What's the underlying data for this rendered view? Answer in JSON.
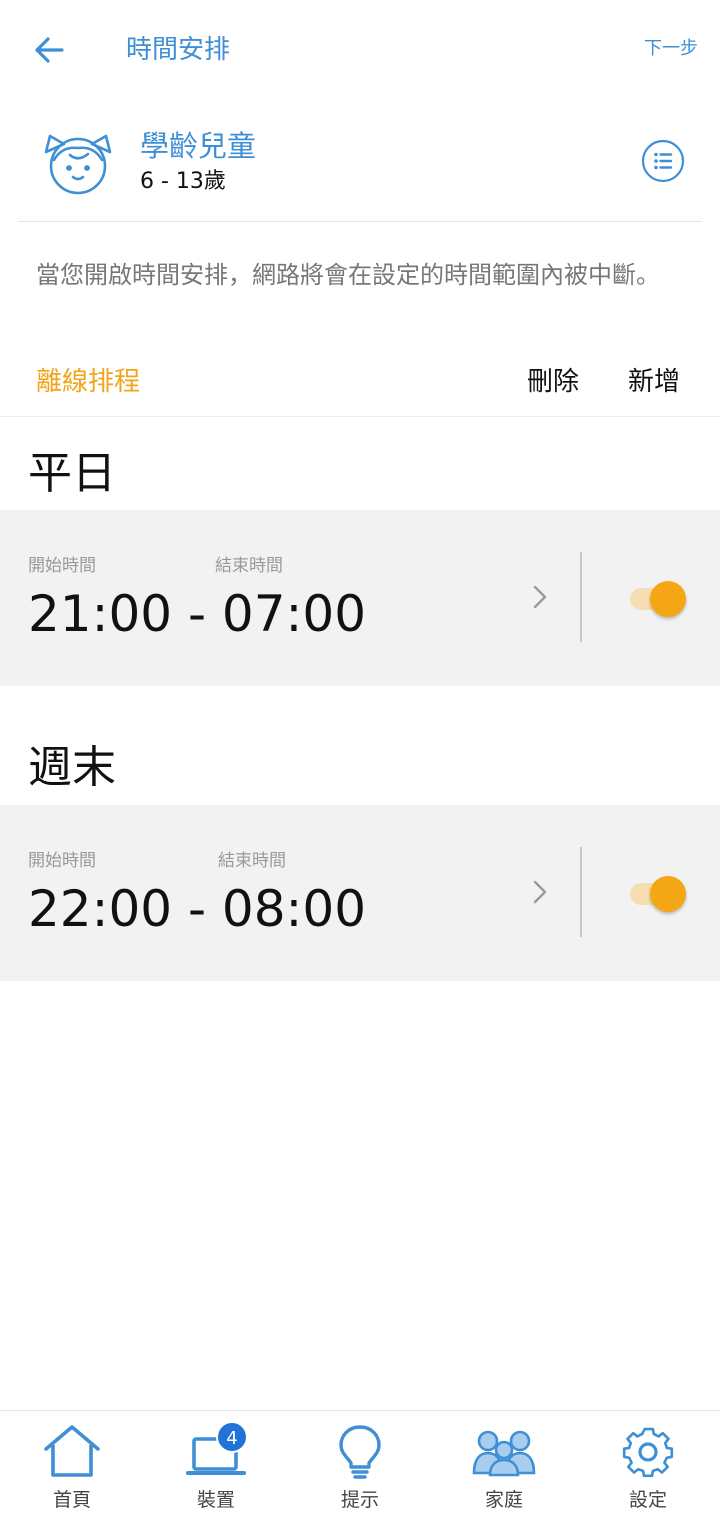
{
  "header": {
    "title": "時間安排",
    "next_label": "下一步"
  },
  "profile": {
    "name": "學齡兒童",
    "age_range": "6 - 13歲"
  },
  "description": "當您開啟時間安排，網路將會在設定的時間範圍內被中斷。",
  "schedule_bar": {
    "title": "離線排程",
    "delete_label": "刪除",
    "add_label": "新增"
  },
  "sections": [
    {
      "title": "平日",
      "start_label": "開始時間",
      "end_label": "結束時間",
      "time_range": "21:00 - 07:00",
      "enabled": true
    },
    {
      "title": "週末",
      "start_label": "開始時間",
      "end_label": "結束時間",
      "time_range": "22:00 - 08:00",
      "enabled": true
    }
  ],
  "tabs": [
    {
      "label": "首頁",
      "icon": "home-icon"
    },
    {
      "label": "裝置",
      "icon": "laptop-icon",
      "badge": "4"
    },
    {
      "label": "提示",
      "icon": "lightbulb-icon"
    },
    {
      "label": "家庭",
      "icon": "family-icon"
    },
    {
      "label": "設定",
      "icon": "gear-icon"
    }
  ],
  "colors": {
    "accent_blue": "#3f8fd6",
    "accent_orange": "#f2a51a",
    "row_background": "#f2f2f2"
  }
}
